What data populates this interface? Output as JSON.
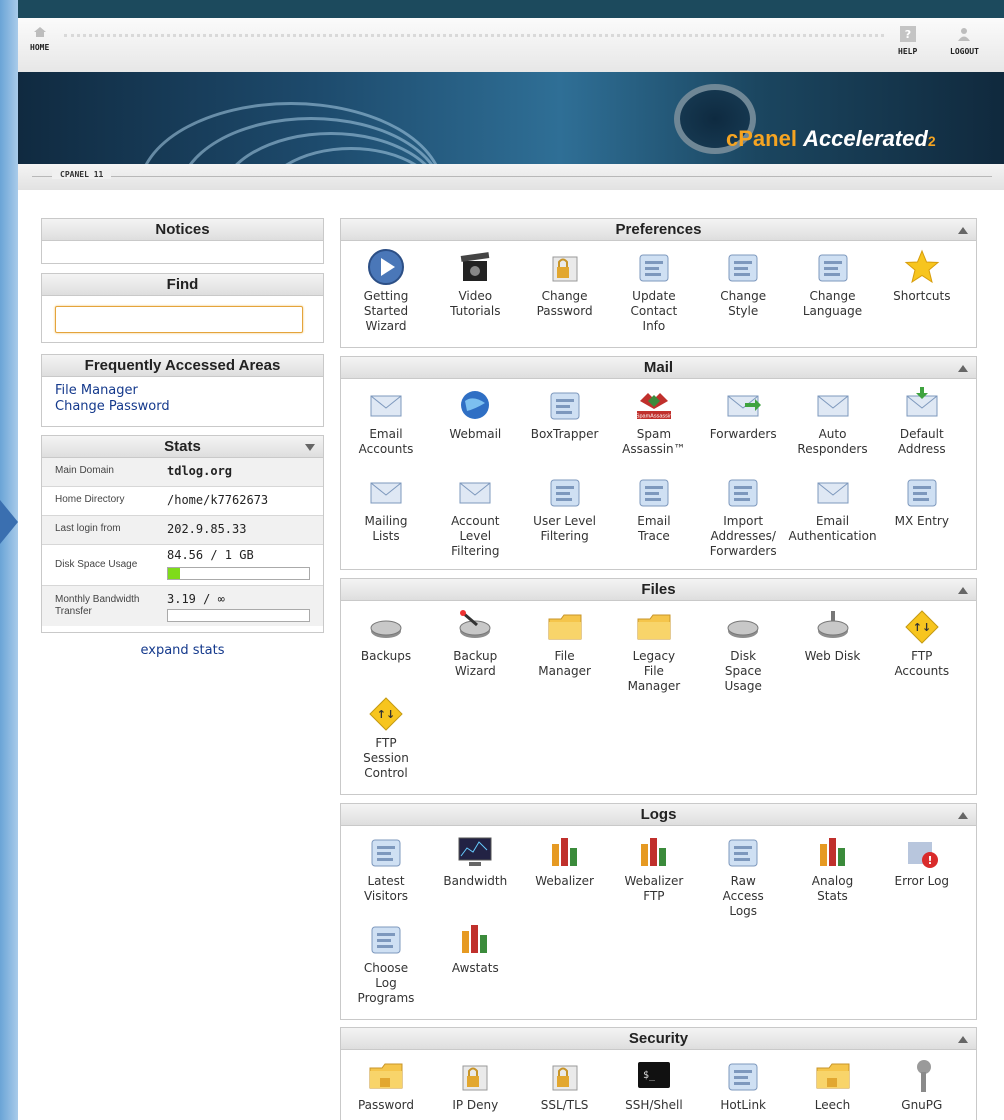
{
  "topnav": {
    "home_label": "HOME",
    "help_label": "HELP",
    "logout_label": "LOGOUT"
  },
  "banner": {
    "logo_cp": "cPanel",
    "logo_accelerated": "Accelerated",
    "logo_version": "2"
  },
  "breadcrumb": {
    "label": "CPANEL 11"
  },
  "notices": {
    "title": "Notices"
  },
  "find": {
    "title": "Find",
    "value": ""
  },
  "faa": {
    "title": "Frequently Accessed Areas",
    "links": [
      "File Manager",
      "Change Password"
    ]
  },
  "stats": {
    "title": "Stats",
    "rows": [
      {
        "label": "Main Domain",
        "value": "tdlog.org"
      },
      {
        "label": "Home Directory",
        "value": "/home/k7762673"
      },
      {
        "label": "Last login from",
        "value": "202.9.85.33"
      },
      {
        "label": "Disk Space Usage",
        "value": "84.56 / 1 GB",
        "fill": 0.0826
      },
      {
        "label": "Monthly Bandwidth Transfer",
        "value": "3.19 / ∞",
        "fill": 0
      }
    ],
    "expand_label": "expand stats"
  },
  "sections": {
    "preferences": {
      "title": "Preferences",
      "items": [
        {
          "label": "Getting\nStarted\nWizard",
          "icon": "play-icon"
        },
        {
          "label": "Video\nTutorials",
          "icon": "clapper-icon"
        },
        {
          "label": "Change\nPassword",
          "icon": "lock-password-icon"
        },
        {
          "label": "Update\nContact\nInfo",
          "icon": "contact-pad-icon"
        },
        {
          "label": "Change\nStyle",
          "icon": "style-paint-icon"
        },
        {
          "label": "Change\nLanguage",
          "icon": "language-icon"
        },
        {
          "label": "Shortcuts",
          "icon": "star-icon"
        }
      ]
    },
    "mail": {
      "title": "Mail",
      "items": [
        {
          "label": "Email\nAccounts",
          "icon": "envelope-icon"
        },
        {
          "label": "Webmail",
          "icon": "webmail-globe-icon"
        },
        {
          "label": "BoxTrapper",
          "icon": "boxtrapper-icon"
        },
        {
          "label": "Spam\nAssassin™",
          "icon": "spamassassin-icon",
          "badge": "SpamAssassin"
        },
        {
          "label": "Forwarders",
          "icon": "forward-envelope-icon"
        },
        {
          "label": "Auto\nResponders",
          "icon": "autoresponder-icon"
        },
        {
          "label": "Default\nAddress",
          "icon": "default-address-icon"
        },
        {
          "label": "Mailing\nLists",
          "icon": "mailing-list-icon"
        },
        {
          "label": "Account\nLevel\nFiltering",
          "icon": "filter-envelope-icon"
        },
        {
          "label": "User Level\nFiltering",
          "icon": "user-filter-icon"
        },
        {
          "label": "Email\nTrace",
          "icon": "email-trace-icon"
        },
        {
          "label": "Import\nAddresses/\nForwarders",
          "icon": "import-box-icon"
        },
        {
          "label": "Email\nAuthentication",
          "icon": "email-auth-icon"
        },
        {
          "label": "MX Entry",
          "icon": "mx-server-icon"
        }
      ]
    },
    "files": {
      "title": "Files",
      "items": [
        {
          "label": "Backups",
          "icon": "disk-icon"
        },
        {
          "label": "Backup\nWizard",
          "icon": "wand-disk-icon"
        },
        {
          "label": "File\nManager",
          "icon": "folder-icon"
        },
        {
          "label": "Legacy\nFile\nManager",
          "icon": "legacy-folder-icon"
        },
        {
          "label": "Disk\nSpace\nUsage",
          "icon": "disk-usage-icon"
        },
        {
          "label": "Web Disk",
          "icon": "network-disk-icon"
        },
        {
          "label": "FTP\nAccounts",
          "icon": "ftp-icon"
        },
        {
          "label": "FTP\nSession\nControl",
          "icon": "ftp-session-icon"
        }
      ]
    },
    "logs": {
      "title": "Logs",
      "items": [
        {
          "label": "Latest\nVisitors",
          "icon": "visitors-icon"
        },
        {
          "label": "Bandwidth",
          "icon": "bandwidth-monitor-icon"
        },
        {
          "label": "Webalizer",
          "icon": "webalizer-bars-icon"
        },
        {
          "label": "Webalizer\nFTP",
          "icon": "webalizer-ftp-icon"
        },
        {
          "label": "Raw\nAccess\nLogs",
          "icon": "raw-log-icon"
        },
        {
          "label": "Analog\nStats",
          "icon": "analog-bars-icon"
        },
        {
          "label": "Error Log",
          "icon": "error-log-icon"
        },
        {
          "label": "Choose\nLog\nPrograms",
          "icon": "choose-log-icon"
        },
        {
          "label": "Awstats",
          "icon": "awstats-icon"
        }
      ]
    },
    "security": {
      "title": "Security",
      "items": [
        {
          "label": "Password",
          "icon": "password-folder-icon"
        },
        {
          "label": "IP Deny",
          "icon": "ip-deny-icon"
        },
        {
          "label": "SSL/TLS",
          "icon": "ssl-icon"
        },
        {
          "label": "SSH/Shell",
          "icon": "terminal-icon"
        },
        {
          "label": "HotLink",
          "icon": "hotlink-chain-icon"
        },
        {
          "label": "Leech",
          "icon": "leech-icon"
        },
        {
          "label": "GnuPG",
          "icon": "keys-icon"
        }
      ]
    }
  }
}
